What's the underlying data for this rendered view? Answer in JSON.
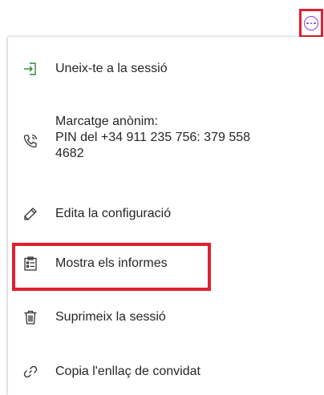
{
  "more_button": {
    "icon": "more-options-icon",
    "accent_color": "#8b3fd1",
    "highlight_color": "#e0202f"
  },
  "menu": {
    "items": [
      {
        "icon": "join-session-icon",
        "label": "Uneix-te a la sessió"
      },
      {
        "icon": "phone-icon",
        "label": "Marcatge anònim:\nPIN del +34 911 235 756: 379 558\n4682"
      },
      {
        "icon": "pencil-icon",
        "label": "Edita la configuració"
      },
      {
        "icon": "clipboard-list-icon",
        "label": "Mostra els informes",
        "highlighted": true
      },
      {
        "icon": "trash-icon",
        "label": "Suprimeix la sessió"
      },
      {
        "icon": "link-icon",
        "label": "Copia l'enllaç de convidat"
      }
    ]
  }
}
